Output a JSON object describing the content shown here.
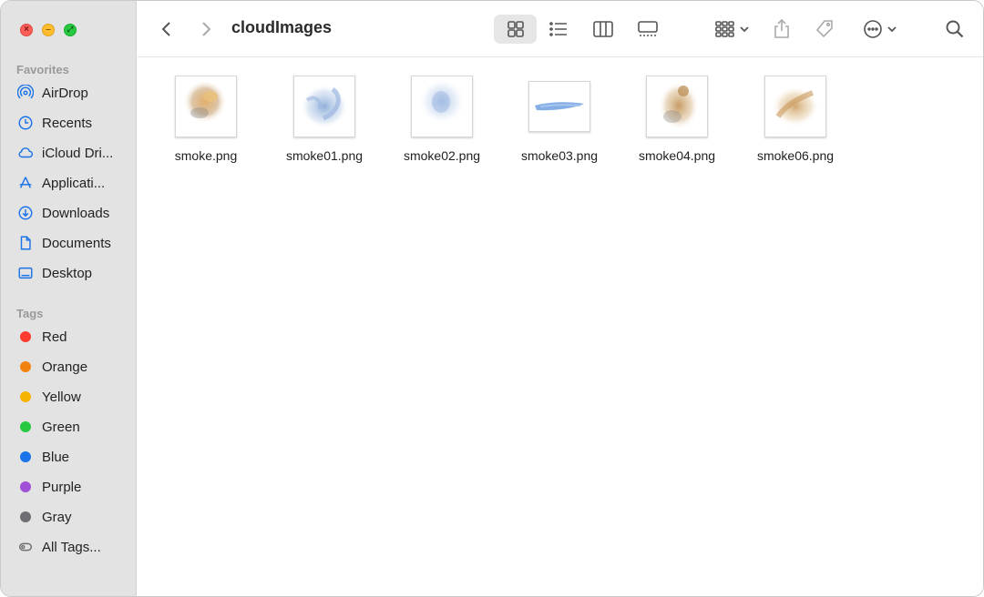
{
  "window": {
    "title": "cloudImages"
  },
  "sidebar": {
    "favorites_title": "Favorites",
    "favorites": [
      {
        "label": "AirDrop",
        "icon": "airdrop-icon"
      },
      {
        "label": "Recents",
        "icon": "clock-icon"
      },
      {
        "label": "iCloud Dri...",
        "icon": "cloud-icon"
      },
      {
        "label": "Applicati...",
        "icon": "applications-icon"
      },
      {
        "label": "Downloads",
        "icon": "download-icon"
      },
      {
        "label": "Documents",
        "icon": "document-icon"
      },
      {
        "label": "Desktop",
        "icon": "desktop-icon"
      }
    ],
    "tags_title": "Tags",
    "tags": [
      {
        "label": "Red",
        "color": "#ff3b30"
      },
      {
        "label": "Orange",
        "color": "#ff9500"
      },
      {
        "label": "Yellow",
        "color": "#ffcc00"
      },
      {
        "label": "Green",
        "color": "#28c840"
      },
      {
        "label": "Blue",
        "color": "#007aff"
      },
      {
        "label": "Purple",
        "color": "#af52de"
      },
      {
        "label": "Gray",
        "color": "#8e8e93"
      },
      {
        "label": "All Tags...",
        "color": ""
      }
    ]
  },
  "toolbar": {
    "icons": [
      "chevron-left-icon",
      "chevron-right-icon",
      "grid-view-icon",
      "list-view-icon",
      "column-view-icon",
      "gallery-view-icon",
      "group-icon",
      "share-icon",
      "tag-icon",
      "more-icon",
      "search-icon"
    ]
  },
  "files": [
    {
      "name": "smoke.png",
      "tint": "#c9a070"
    },
    {
      "name": "smoke01.png",
      "tint": "#8fb0d9"
    },
    {
      "name": "smoke02.png",
      "tint": "#a9c2e6"
    },
    {
      "name": "smoke03.png",
      "tint": "#6fa0e0"
    },
    {
      "name": "smoke04.png",
      "tint": "#c79a62"
    },
    {
      "name": "smoke06.png",
      "tint": "#d3a771"
    }
  ]
}
